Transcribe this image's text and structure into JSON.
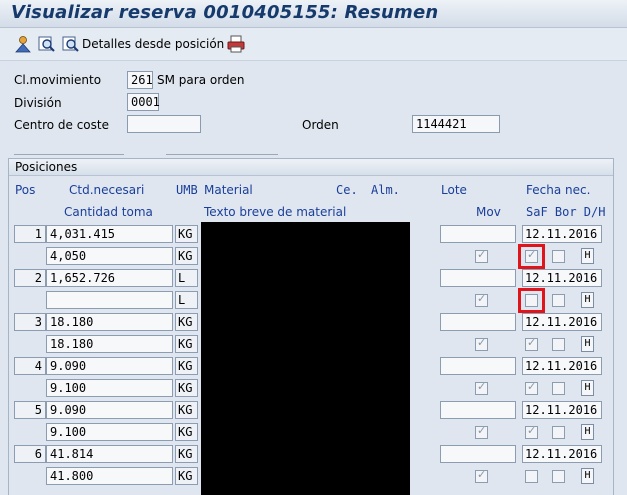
{
  "window": {
    "title": "Visualizar reserva 0010405155: Resumen"
  },
  "toolbar": {
    "details_label": "Detalles desde posición"
  },
  "header": {
    "clmov_label": "Cl.movimiento",
    "clmov_value": "261",
    "clmov_text": "SM para orden",
    "division_label": "División",
    "division_value": "0001",
    "ceco_label": "Centro de coste",
    "ceco_value": "",
    "orden_label": "Orden",
    "orden_value": "1144421"
  },
  "positions": {
    "title": "Posiciones",
    "col_pos": "Pos",
    "col_ctd": "Ctd.necesari",
    "col_umb": "UMB",
    "col_material": "Material",
    "col_ce": "Ce.",
    "col_alm": "Alm.",
    "col_lote": "Lote",
    "col_fecha": "Fecha nec.",
    "col_cant_toma": "Cantidad toma",
    "col_texto": "Texto breve de material",
    "col_mov": "Mov",
    "col_saf_bor_dh": "SaF Bor D/H",
    "items": [
      {
        "pos": "1",
        "qty": "4,031.415",
        "umb": "KG",
        "date": "12.11.2016",
        "qty2": "4,050",
        "umb2": "KG",
        "mov": true,
        "saf": true,
        "bor": false,
        "dh": "H"
      },
      {
        "pos": "2",
        "qty": "1,652.726",
        "umb": "L",
        "date": "12.11.2016",
        "qty2": "",
        "umb2": "L",
        "mov": true,
        "saf": false,
        "bor": false,
        "dh": "H"
      },
      {
        "pos": "3",
        "qty": "18.180",
        "umb": "KG",
        "date": "12.11.2016",
        "qty2": "18.180",
        "umb2": "KG",
        "mov": true,
        "saf": true,
        "bor": false,
        "dh": "H"
      },
      {
        "pos": "4",
        "qty": "9.090",
        "umb": "KG",
        "date": "12.11.2016",
        "qty2": "9.100",
        "umb2": "KG",
        "mov": true,
        "saf": true,
        "bor": false,
        "dh": "H"
      },
      {
        "pos": "5",
        "qty": "9.090",
        "umb": "KG",
        "date": "12.11.2016",
        "qty2": "9.100",
        "umb2": "KG",
        "mov": true,
        "saf": true,
        "bor": false,
        "dh": "H"
      },
      {
        "pos": "6",
        "qty": "41.814",
        "umb": "KG",
        "date": "12.11.2016",
        "qty2": "41.800",
        "umb2": "KG",
        "mov": true,
        "saf": false,
        "bor": false,
        "dh": "H"
      }
    ]
  },
  "colors": {
    "highlight": "#e0141b",
    "header_text": "#1a3f9a",
    "title_text": "#153a6b"
  },
  "icons": [
    "person-icon",
    "find-icon",
    "details-icon",
    "print-icon"
  ]
}
